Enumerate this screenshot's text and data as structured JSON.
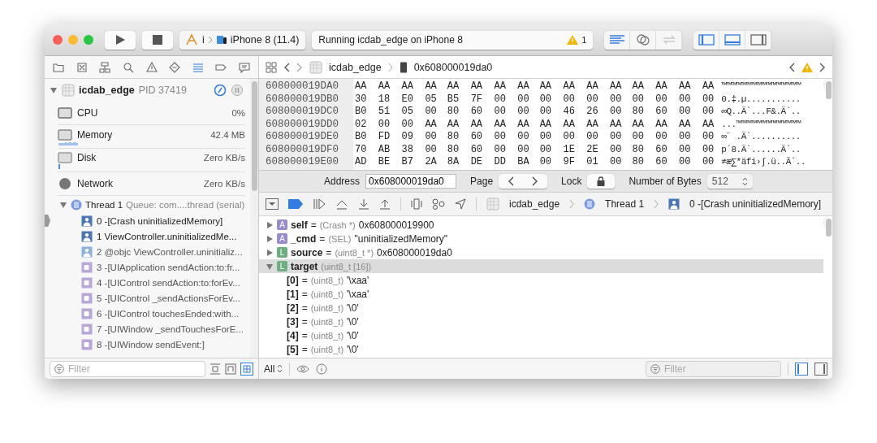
{
  "toolbar": {
    "scheme": {
      "target": "i",
      "device": "iPhone 8 (11.4)"
    },
    "activity": {
      "status": "Running icdab_edge on iPhone 8",
      "warning_count": "1"
    },
    "editor_modes": [
      {
        "kind": "standard",
        "selected": true,
        "disabled": false
      },
      {
        "kind": "assistant",
        "selected": false,
        "disabled": false
      },
      {
        "kind": "version",
        "selected": false,
        "disabled": true
      }
    ],
    "panel_toggles": [
      {
        "kind": "left",
        "selected": true
      },
      {
        "kind": "bottom",
        "selected": true
      },
      {
        "kind": "right",
        "selected": false
      }
    ]
  },
  "navigator": {
    "tabs": [
      {
        "kind": "folder",
        "selected": false
      },
      {
        "kind": "source",
        "selected": false
      },
      {
        "kind": "symbol",
        "selected": false
      },
      {
        "kind": "search",
        "selected": false
      },
      {
        "kind": "issue",
        "selected": false
      },
      {
        "kind": "test",
        "selected": false
      },
      {
        "kind": "debug",
        "selected": true
      },
      {
        "kind": "breakpoint",
        "selected": false
      },
      {
        "kind": "report",
        "selected": false
      }
    ],
    "process": {
      "name": "icdab_edge",
      "pid": "PID 37419",
      "expanded": true
    },
    "gauges": [
      {
        "kind": "cpu",
        "label": "CPU",
        "value": "0%"
      },
      {
        "kind": "memory",
        "label": "Memory",
        "value": "42.4 MB"
      },
      {
        "kind": "disk",
        "label": "Disk",
        "value": "Zero KB/s"
      },
      {
        "kind": "network",
        "label": "Network",
        "value": "Zero KB/s"
      }
    ],
    "thread": {
      "label": "Thread 1",
      "queue": "Queue: com....thread (serial)",
      "expanded": true,
      "frames": [
        {
          "text": "0 -[Crash uninitializedMemory]",
          "kind": "user",
          "current": true
        },
        {
          "text": "1 ViewController.uninitializedMe...",
          "kind": "user",
          "current": false
        },
        {
          "text": "2 @objc ViewController.uninitializ...",
          "kind": "user-light",
          "current": false
        },
        {
          "text": "3 -[UIApplication sendAction:to:fr...",
          "kind": "system",
          "current": false
        },
        {
          "text": "4 -[UIControl sendAction:to:forEv...",
          "kind": "system",
          "current": false
        },
        {
          "text": "5 -[UIControl _sendActionsForEv...",
          "kind": "system",
          "current": false
        },
        {
          "text": "6 -[UIControl touchesEnded:with...",
          "kind": "system",
          "current": false
        },
        {
          "text": "7 -[UIWindow _sendTouchesForE...",
          "kind": "system",
          "current": false
        },
        {
          "text": "8 -[UIWindow sendEvent:]",
          "kind": "system",
          "current": false
        }
      ]
    },
    "filter": {
      "placeholder": "Filter"
    }
  },
  "jump_bar": {
    "items": [
      "icdab_edge",
      "0x608000019da0"
    ]
  },
  "memory": {
    "rows": [
      {
        "address": "608000019DA0",
        "bytes": [
          "AA",
          "AA",
          "AA",
          "AA",
          "AA",
          "AA",
          "AA",
          "AA",
          "AA",
          "AA",
          "AA",
          "AA",
          "AA",
          "AA",
          "AA",
          "AA"
        ],
        "ascii": "™™™™™™™™™™™™™™™™"
      },
      {
        "address": "608000019DB0",
        "bytes": [
          "30",
          "18",
          "E0",
          "05",
          "B5",
          "7F",
          "00",
          "00",
          "00",
          "00",
          "00",
          "00",
          "00",
          "00",
          "00",
          "00"
        ],
        "ascii": "0.‡.µ..........."
      },
      {
        "address": "608000019DC0",
        "bytes": [
          "B0",
          "51",
          "05",
          "00",
          "80",
          "60",
          "00",
          "00",
          "00",
          "46",
          "26",
          "00",
          "80",
          "60",
          "00",
          "00"
        ],
        "ascii": "∞Q..Ä`...F&.Ä`.."
      },
      {
        "address": "608000019DD0",
        "bytes": [
          "02",
          "00",
          "00",
          "AA",
          "AA",
          "AA",
          "AA",
          "AA",
          "AA",
          "AA",
          "AA",
          "AA",
          "AA",
          "AA",
          "AA",
          "AA"
        ],
        "ascii": "...™™™™™™™™™™™™™"
      },
      {
        "address": "608000019DE0",
        "bytes": [
          "B0",
          "FD",
          "09",
          "00",
          "80",
          "60",
          "00",
          "00",
          "00",
          "00",
          "00",
          "00",
          "00",
          "00",
          "00",
          "00"
        ],
        "ascii": "∞˝ .Ä`.........."
      },
      {
        "address": "608000019DF0",
        "bytes": [
          "70",
          "AB",
          "38",
          "00",
          "80",
          "60",
          "00",
          "00",
          "00",
          "1E",
          "2E",
          "00",
          "80",
          "60",
          "00",
          "00"
        ],
        "ascii": "p´8.Ä`......Ä`.."
      },
      {
        "address": "608000019E00",
        "bytes": [
          "AD",
          "BE",
          "B7",
          "2A",
          "8A",
          "DE",
          "DD",
          "BA",
          "00",
          "9F",
          "01",
          "00",
          "80",
          "60",
          "00",
          "00"
        ],
        "ascii": "≠æ∑*äfi›∫.ü..Ä`.."
      }
    ],
    "address_label": "Address",
    "address": "0x608000019da0",
    "page_label": "Page",
    "lock_label": "Lock",
    "bytes_label": "Number of Bytes",
    "bytes_value": "512"
  },
  "debug_bar": {
    "breakpoints_active": true,
    "breadcrumbs": [
      {
        "kind": "app",
        "text": "icdab_edge"
      },
      {
        "kind": "thread",
        "text": "Thread 1"
      },
      {
        "kind": "frame",
        "text": "0 -[Crash uninitializedMemory]"
      }
    ]
  },
  "variables": [
    {
      "badge": "A",
      "kind": "argument",
      "name": "self",
      "sep": "=",
      "type": "(Crash *)",
      "value": "0x608000019900",
      "expanded": false,
      "selected": false
    },
    {
      "badge": "A",
      "kind": "argument",
      "name": "_cmd",
      "sep": "=",
      "type": "(SEL)",
      "value": "\"uninitializedMemory\"",
      "expanded": false,
      "selected": false
    },
    {
      "badge": "L",
      "kind": "local",
      "name": "source",
      "sep": "=",
      "type": "(uint8_t *)",
      "value": "0x608000019da0",
      "expanded": false,
      "selected": false
    },
    {
      "badge": "L",
      "kind": "local",
      "name": "target",
      "type": "(uint8_t [16])",
      "expanded": true,
      "selected": true,
      "children": [
        {
          "name": "[0]",
          "sep": "=",
          "type": "(uint8_t)",
          "value": "'\\xaa'"
        },
        {
          "name": "[1]",
          "sep": "=",
          "type": "(uint8_t)",
          "value": "'\\xaa'"
        },
        {
          "name": "[2]",
          "sep": "=",
          "type": "(uint8_t)",
          "value": "'\\0'"
        },
        {
          "name": "[3]",
          "sep": "=",
          "type": "(uint8_t)",
          "value": "'\\0'"
        },
        {
          "name": "[4]",
          "sep": "=",
          "type": "(uint8_t)",
          "value": "'\\0'"
        },
        {
          "name": "[5]",
          "sep": "=",
          "type": "(uint8_t)",
          "value": "'\\0'"
        }
      ]
    }
  ],
  "variables_bar": {
    "scope": "All",
    "filter_placeholder": "Filter"
  }
}
